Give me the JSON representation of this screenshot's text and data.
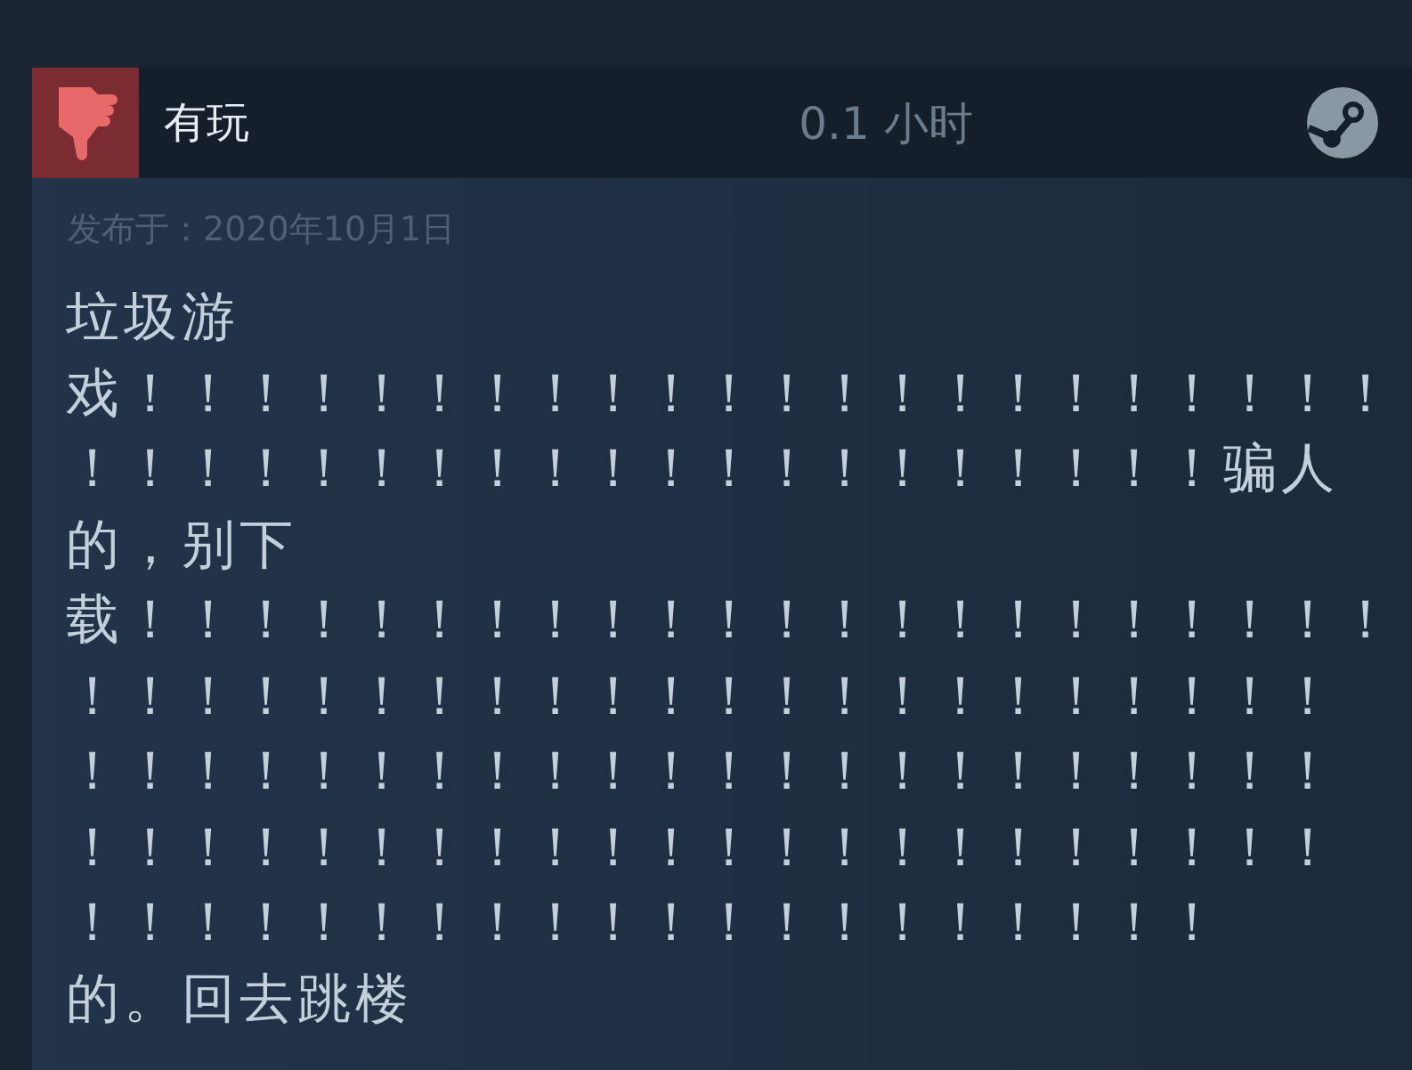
{
  "review": {
    "recommended": false,
    "label": "有玩",
    "hours": "0.1 小时",
    "posted": "发布于：2020年10月1日",
    "lines": [
      "垃圾游",
      "戏！！！！！！！！！！！！！！！！！！！！！！",
      "！！！！！！！！！！！！！！！！！！！！骗人",
      "的，别下",
      "载！！！！！！！！！！！！！！！！！！！！！！",
      "！！！！！！！！！！！！！！！！！！！！！！",
      "！！！！！！！！！！！！！！！！！！！！！！",
      "！！！！！！！！！！！！！！！！！！！！！！",
      "！！！！！！！！！！！！！！！！！！！！",
      "的。回去跳楼"
    ]
  }
}
